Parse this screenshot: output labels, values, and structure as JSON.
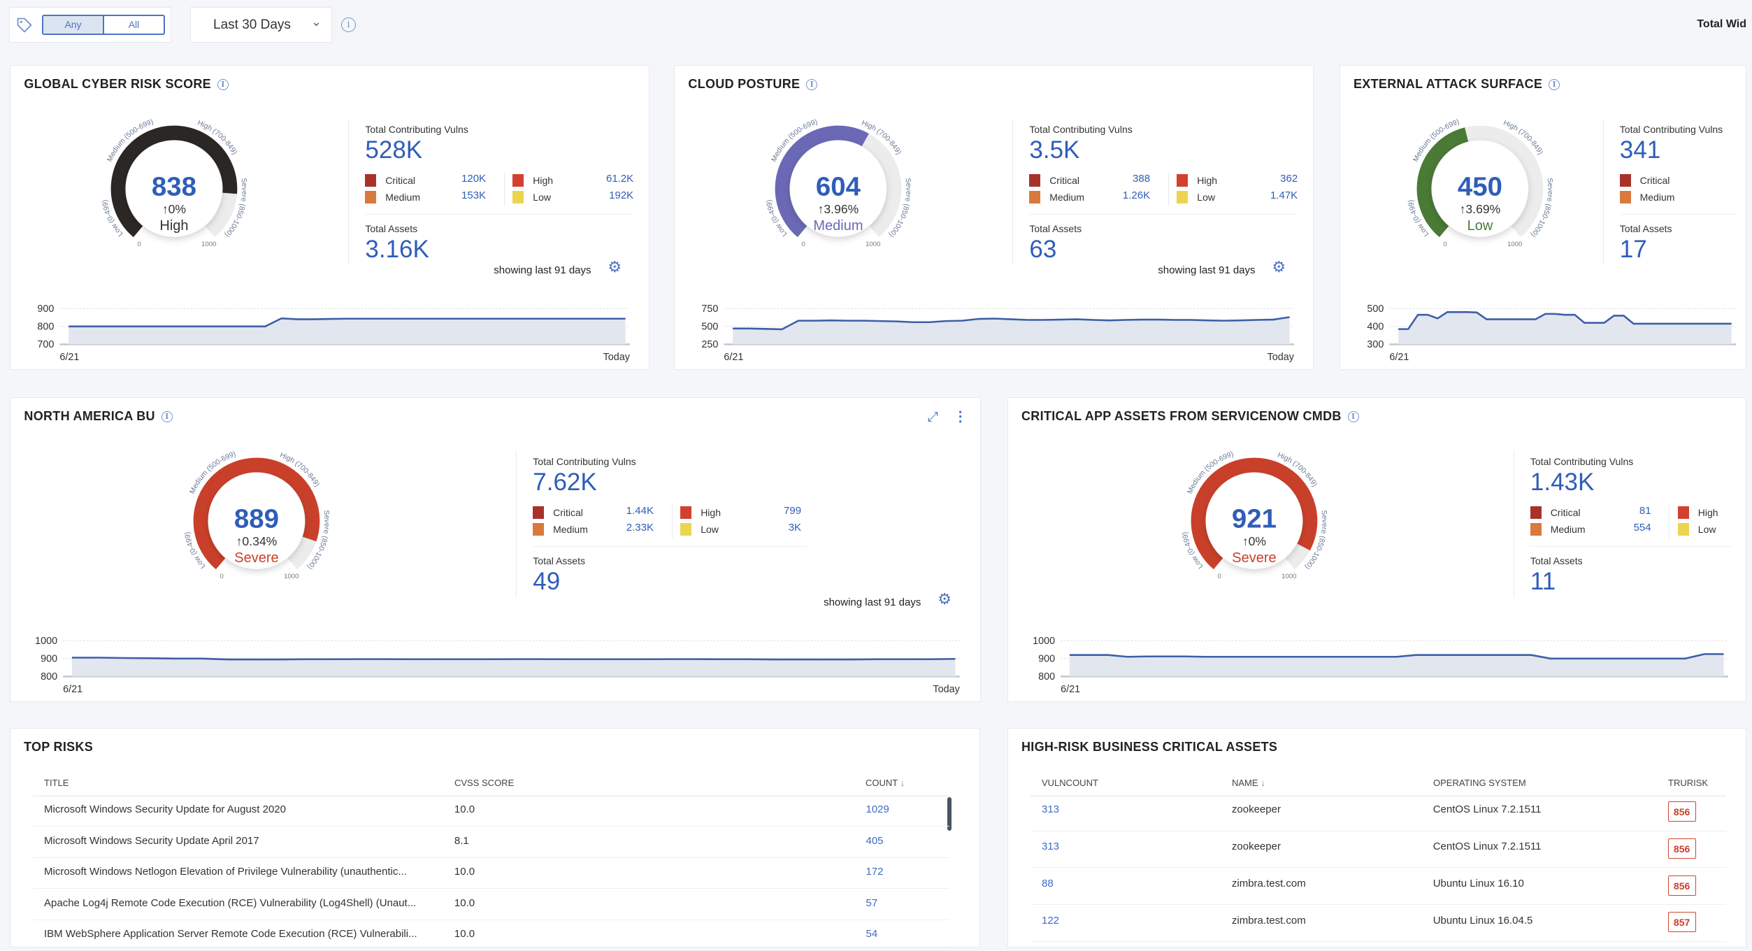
{
  "toolbar": {
    "tag_icon": "tag-icon",
    "match_options": [
      "Any",
      "All"
    ],
    "match_selected": "Any",
    "date_range": "Last 30 Days",
    "info_icon": "info-icon",
    "total_widgets_label": "Total Wid"
  },
  "level_colors": {
    "Low": "#4a7a35",
    "Medium": "#6b69b5",
    "High": "#2b2724",
    "Severe": "#c9402a"
  },
  "legend_colors": {
    "Critical": "#a8322a",
    "Medium": "#d9793d",
    "High": "#d2412f",
    "Low": "#ecd54e"
  },
  "gauge_labels": {
    "low": "Low (0-499)",
    "medium": "Medium (500-699)",
    "high": "High (700-849)",
    "severe": "Severe (850-1000)",
    "min": "0",
    "max": "1000"
  },
  "common": {
    "total_vulns_label": "Total Contributing Vulns",
    "total_assets_label": "Total Assets",
    "showing_label": "showing last 91 days",
    "x_start": "6/21",
    "x_end": "Today"
  },
  "cards": [
    {
      "title": "Global Cyber Risk Score",
      "score": 838,
      "change": "↑0%",
      "level": "High",
      "total_vulns": "528K",
      "legend": [
        {
          "label": "Critical",
          "value": "120K"
        },
        {
          "label": "Medium",
          "value": "153K"
        },
        {
          "label": "High",
          "value": "61.2K"
        },
        {
          "label": "Low",
          "value": "192K"
        }
      ],
      "total_assets": "3.16K",
      "show_days": true,
      "chart_data": {
        "type": "area",
        "ylim": [
          700,
          900
        ],
        "yticks": [
          "900",
          "800",
          "700"
        ],
        "values": [
          800,
          800,
          800,
          800,
          800,
          800,
          800,
          800,
          800,
          800,
          800,
          800,
          800,
          845,
          840,
          840,
          842,
          843,
          843,
          843,
          843,
          843,
          843,
          843,
          843,
          843,
          843,
          843,
          843,
          843,
          843,
          843,
          843,
          843,
          843
        ]
      }
    },
    {
      "title": "Cloud Posture",
      "score": 604,
      "change": "↑3.96%",
      "level": "Medium",
      "total_vulns": "3.5K",
      "legend": [
        {
          "label": "Critical",
          "value": "388"
        },
        {
          "label": "Medium",
          "value": "1.26K"
        },
        {
          "label": "High",
          "value": "362"
        },
        {
          "label": "Low",
          "value": "1.47K"
        }
      ],
      "total_assets": "63",
      "show_days": true,
      "chart_data": {
        "type": "area",
        "ylim": [
          250,
          750
        ],
        "yticks": [
          "750",
          "500",
          "250"
        ],
        "values": [
          470,
          470,
          465,
          460,
          580,
          580,
          585,
          580,
          580,
          575,
          570,
          560,
          560,
          575,
          580,
          605,
          610,
          600,
          590,
          590,
          595,
          600,
          590,
          585,
          590,
          595,
          595,
          590,
          590,
          585,
          580,
          585,
          590,
          595,
          630
        ]
      }
    },
    {
      "title": "External Attack Surface",
      "score": 450,
      "change": "↑3.69%",
      "level": "Low",
      "total_vulns": "341",
      "legend": [
        {
          "label": "Critical",
          "value": ""
        },
        {
          "label": "Medium",
          "value": ""
        }
      ],
      "total_assets": "17",
      "show_days": false,
      "chart_data": {
        "type": "area",
        "ylim": [
          300,
          500
        ],
        "yticks": [
          "500",
          "400",
          "300"
        ],
        "values": [
          385,
          385,
          465,
          465,
          445,
          480,
          480,
          480,
          478,
          440,
          440,
          440,
          440,
          440,
          440,
          470,
          470,
          465,
          465,
          420,
          420,
          420,
          460,
          460,
          415,
          415,
          415,
          415,
          415,
          415,
          415,
          415,
          415,
          415,
          415
        ]
      }
    },
    {
      "title": "North America BU",
      "score": 889,
      "change": "↑0.34%",
      "level": "Severe",
      "total_vulns": "7.62K",
      "legend": [
        {
          "label": "Critical",
          "value": "1.44K"
        },
        {
          "label": "Medium",
          "value": "2.33K"
        },
        {
          "label": "High",
          "value": "799"
        },
        {
          "label": "Low",
          "value": "3K"
        }
      ],
      "total_assets": "49",
      "show_days": true,
      "actions": true,
      "chart_data": {
        "type": "area",
        "ylim": [
          800,
          1000
        ],
        "yticks": [
          "1000",
          "900",
          "800"
        ],
        "values": [
          905,
          905,
          903,
          902,
          900,
          900,
          895,
          895,
          895,
          896,
          896,
          897,
          897,
          896,
          896,
          896,
          896,
          897,
          897,
          896,
          896,
          896,
          896,
          897,
          897,
          896,
          896,
          895,
          895,
          895,
          895,
          896,
          896,
          896,
          898
        ]
      }
    },
    {
      "title": "Critical App Assets from ServiceNow CMDB",
      "score": 921,
      "change": "↑0%",
      "level": "Severe",
      "total_vulns": "1.43K",
      "legend": [
        {
          "label": "Critical",
          "value": "81"
        },
        {
          "label": "Medium",
          "value": "554"
        },
        {
          "label": "High",
          "value": ""
        },
        {
          "label": "Low",
          "value": ""
        }
      ],
      "total_assets": "11",
      "show_days": false,
      "chart_data": {
        "type": "area",
        "ylim": [
          800,
          1000
        ],
        "yticks": [
          "1000",
          "900",
          "800"
        ],
        "values": [
          920,
          920,
          920,
          910,
          912,
          912,
          912,
          910,
          910,
          910,
          910,
          910,
          910,
          910,
          910,
          910,
          910,
          910,
          920,
          920,
          920,
          920,
          920,
          920,
          920,
          900,
          900,
          900,
          900,
          900,
          900,
          900,
          900,
          925,
          925
        ]
      }
    }
  ],
  "top_risks": {
    "title": "Top Risks",
    "columns": [
      "Title",
      "CVSS Score",
      "Count"
    ],
    "sort_icon": "arrow-down-icon",
    "rows": [
      {
        "title": "Microsoft Windows Security Update for August 2020",
        "cvss": "10.0",
        "count": "1029"
      },
      {
        "title": "Microsoft Windows Security Update April 2017",
        "cvss": "8.1",
        "count": "405"
      },
      {
        "title": "Microsoft Windows Netlogon Elevation of Privilege Vulnerability (unauthentic...",
        "cvss": "10.0",
        "count": "172"
      },
      {
        "title": "Apache Log4j Remote Code Execution (RCE) Vulnerability (Log4Shell) (Unaut...",
        "cvss": "10.0",
        "count": "57"
      },
      {
        "title": "IBM WebSphere Application Server Remote Code Execution (RCE) Vulnerabili...",
        "cvss": "10.0",
        "count": "54"
      }
    ]
  },
  "high_risk_assets": {
    "title": "High-Risk Business Critical Assets",
    "columns": [
      "Vulncount",
      "Name",
      "Operating System",
      "TruRisk"
    ],
    "rows": [
      {
        "vulncount": "313",
        "name": "zookeeper",
        "os": "CentOS Linux 7.2.1511",
        "trurisk": "856"
      },
      {
        "vulncount": "313",
        "name": "zookeeper",
        "os": "CentOS Linux 7.2.1511",
        "trurisk": "856"
      },
      {
        "vulncount": "88",
        "name": "zimbra.test.com",
        "os": "Ubuntu Linux 16.10",
        "trurisk": "856"
      },
      {
        "vulncount": "122",
        "name": "zimbra.test.com",
        "os": "Ubuntu Linux 16.04.5",
        "trurisk": "857"
      }
    ]
  }
}
